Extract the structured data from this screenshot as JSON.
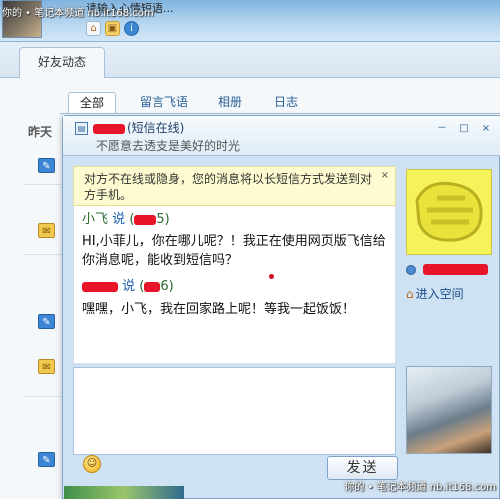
{
  "watermark": "你的 • 笔记本频道 nb.it168.com",
  "profile": {
    "status_placeholder": "请输入心情短语..."
  },
  "main_tabs": [
    {
      "label": "好友动态"
    }
  ],
  "sub_tabs": [
    {
      "label": "全部",
      "active": true
    },
    {
      "label": "留言飞语",
      "active": false
    },
    {
      "label": "相册",
      "active": false
    },
    {
      "label": "日志",
      "active": false
    }
  ],
  "feed": {
    "day_label": "昨天",
    "icons": [
      "chat-bubble-icon",
      "note-icon",
      "chat-bubble-icon",
      "chat-bubble-icon",
      "note-icon",
      "chat-bubble-icon"
    ]
  },
  "chat": {
    "status": "(短信在线)",
    "signature": "不愿意去透支是美好的时光",
    "notice": "对方不在线或隐身，您的消息将以长短信方式发送到对方手机。",
    "notice_close": "×",
    "messages": [
      {
        "sender": "小飞",
        "says": "说",
        "time_tail": "5)",
        "text": "HI,小菲儿，你在哪儿呢？！我正在使用网页版飞信给你消息呢，能收到短信吗？"
      },
      {
        "sender": "",
        "says": "说",
        "time_tail": "6)",
        "text": "嘿嘿，小飞，我在回家路上呢！等我一起饭饭！"
      }
    ],
    "send_label": "发送",
    "space_link": "进入空间",
    "window_buttons": {
      "min": "－",
      "max": "□",
      "close": "×"
    },
    "colors": {
      "redaction": "#e8142a",
      "notice_bg": "#fdfbcf",
      "avatar_highlight": "#f5f25a"
    }
  }
}
